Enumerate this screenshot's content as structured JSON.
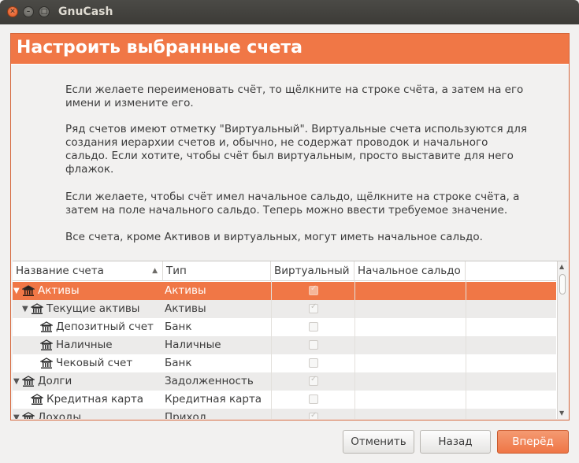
{
  "window": {
    "title": "GnuCash"
  },
  "page": {
    "heading": "Настроить выбранные счета",
    "paragraphs": [
      [
        "Если желаете переименовать счёт, то щёлкните на строке счёта, а затем на его",
        "имени и измените его."
      ],
      [
        "Ряд счетов имеют отметку \"Виртуальный\". Виртуальные счета используются для",
        "создания иерархии счетов и, обычно, не содержат проводок и начального",
        "сальдо. Если хотите, чтобы счёт был виртуальным, просто выставите для него",
        "флажок."
      ],
      [
        "Если желаете, чтобы счёт имел начальное сальдо, щёлкните на строке счёта, а",
        "затем на поле начального сальдо. Теперь можно ввести требуемое значение."
      ],
      [
        "Все счета, кроме Активов и виртуальных, могут иметь начальное сальдо."
      ]
    ]
  },
  "table": {
    "columns": [
      "Название счета",
      "Тип",
      "Виртуальный",
      "Начальное сальдо"
    ],
    "rows": [
      {
        "name": "Активы",
        "type": "Активы",
        "virtual": true,
        "level": 0,
        "expander": "▼",
        "selected": true
      },
      {
        "name": "Текущие активы",
        "type": "Активы",
        "virtual": true,
        "level": 1,
        "expander": "▼",
        "selected": false
      },
      {
        "name": "Депозитный счет",
        "type": "Банк",
        "virtual": false,
        "level": 2,
        "expander": "",
        "selected": false
      },
      {
        "name": "Наличные",
        "type": "Наличные",
        "virtual": false,
        "level": 2,
        "expander": "",
        "selected": false
      },
      {
        "name": "Чековый счет",
        "type": "Банк",
        "virtual": false,
        "level": 2,
        "expander": "",
        "selected": false
      },
      {
        "name": "Долги",
        "type": "Задолженность",
        "virtual": true,
        "level": 0,
        "expander": "▼",
        "selected": false
      },
      {
        "name": "Кредитная карта",
        "type": "Кредитная карта",
        "virtual": false,
        "level": 1,
        "expander": "",
        "selected": false
      },
      {
        "name": "Доходы",
        "type": "Приход",
        "virtual": true,
        "level": 0,
        "expander": "▼",
        "selected": false
      }
    ]
  },
  "buttons": {
    "cancel": "Отменить",
    "back": "Назад",
    "forward": "Вперёд"
  },
  "colors": {
    "accent": "#f07746",
    "titlebar": "#3c3b37"
  }
}
